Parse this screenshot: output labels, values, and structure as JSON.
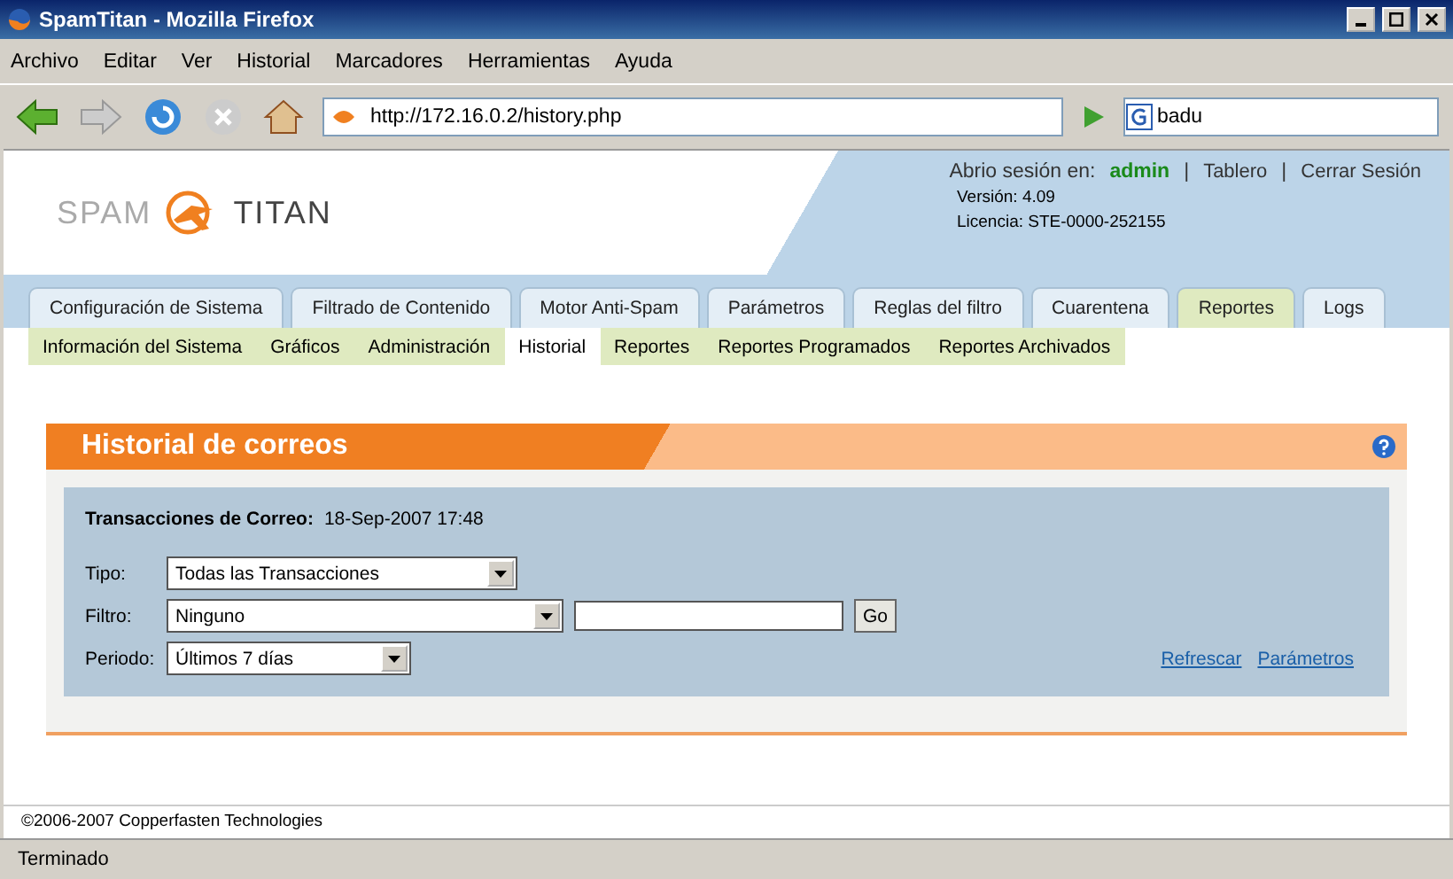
{
  "window": {
    "title": "SpamTitan - Mozilla Firefox"
  },
  "menu": [
    "Archivo",
    "Editar",
    "Ver",
    "Historial",
    "Marcadores",
    "Herramientas",
    "Ayuda"
  ],
  "address": {
    "value": "http://172.16.0.2/history.php"
  },
  "search": {
    "value": "badu"
  },
  "logo": {
    "left": "SPAM",
    "right": "TITAN"
  },
  "session": {
    "label": "Abrio sesión en:",
    "user": "admin",
    "links": [
      "Tablero",
      "Cerrar Sesión"
    ],
    "separator": "|",
    "version": "Versión: 4.09",
    "license": "Licencia: STE-0000-252155"
  },
  "tabs": [
    {
      "label": "Configuración de Sistema",
      "selected": false
    },
    {
      "label": "Filtrado de Contenido",
      "selected": false
    },
    {
      "label": "Motor Anti-Spam",
      "selected": false
    },
    {
      "label": "Parámetros",
      "selected": false
    },
    {
      "label": "Reglas del filtro",
      "selected": false
    },
    {
      "label": "Cuarentena",
      "selected": false
    },
    {
      "label": "Reportes",
      "selected": true
    },
    {
      "label": "Logs",
      "selected": false
    }
  ],
  "subtabs": [
    {
      "label": "Información del Sistema",
      "selected": false
    },
    {
      "label": "Gráficos",
      "selected": false
    },
    {
      "label": "Administración",
      "selected": false
    },
    {
      "label": "Historial",
      "selected": true
    },
    {
      "label": "Reportes",
      "selected": false
    },
    {
      "label": "Reportes Programados",
      "selected": false
    },
    {
      "label": "Reportes Archivados",
      "selected": false
    }
  ],
  "panel": {
    "title": "Historial de correos",
    "heading": "Transacciones de Correo:",
    "timestamp": "18-Sep-2007 17:48",
    "fields": [
      {
        "label": "Tipo:",
        "value": "Todas las Transacciones",
        "kind": "select"
      },
      {
        "label": "Filtro:",
        "value": "Ninguno",
        "kind": "select-text"
      },
      {
        "label": "Periodo:",
        "value": "Últimos 7 días",
        "kind": "select"
      }
    ],
    "go": "Go",
    "links": [
      "Refrescar",
      "Parámetros"
    ]
  },
  "footer": "©2006-2007 Copperfasten Technologies",
  "status_bar": "Terminado"
}
